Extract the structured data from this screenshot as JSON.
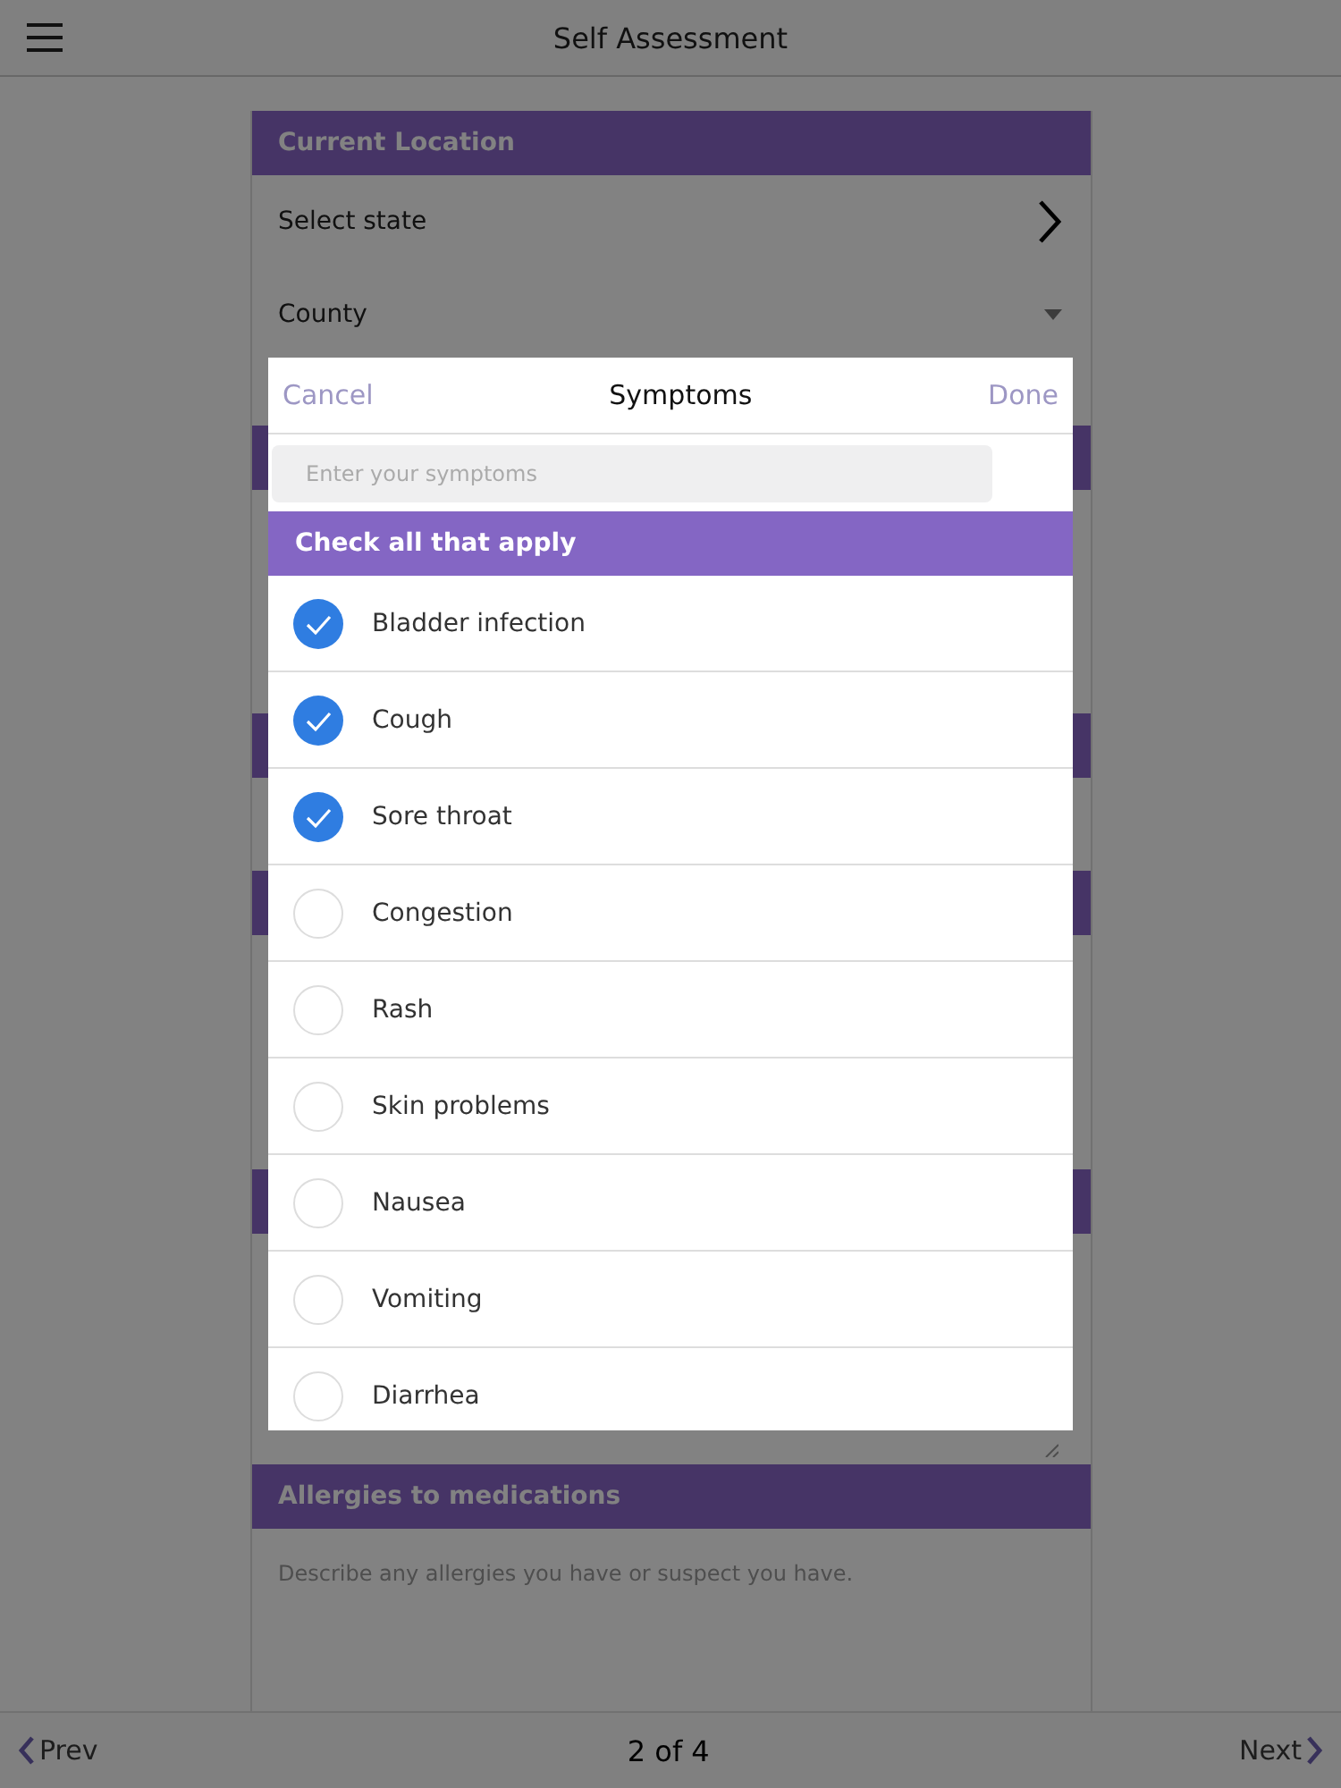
{
  "app_bar": {
    "title": "Self Assessment"
  },
  "sections": [
    {
      "kind": "location",
      "title": "Current Location",
      "state_label": "Select state",
      "county_label": "County"
    },
    {
      "kind": "covered"
    },
    {
      "kind": "covered"
    },
    {
      "kind": "covered"
    },
    {
      "kind": "covered"
    },
    {
      "kind": "textarea",
      "title": "Allergies to medications",
      "placeholder": "Describe any allergies you have or suspect you have."
    }
  ],
  "modal": {
    "cancel": "Cancel",
    "title": "Symptoms",
    "done": "Done",
    "search_placeholder": "Enter your symptoms",
    "banner": "Check all that apply",
    "items": [
      {
        "label": "Bladder infection",
        "checked": true
      },
      {
        "label": "Cough",
        "checked": true
      },
      {
        "label": "Sore throat",
        "checked": true
      },
      {
        "label": "Congestion",
        "checked": false
      },
      {
        "label": "Rash",
        "checked": false
      },
      {
        "label": "Skin problems",
        "checked": false
      },
      {
        "label": "Nausea",
        "checked": false
      },
      {
        "label": "Vomiting",
        "checked": false
      },
      {
        "label": "Diarrhea",
        "checked": false
      }
    ]
  },
  "footer": {
    "prev": "Prev",
    "page": "2 of 4",
    "next": "Next"
  }
}
